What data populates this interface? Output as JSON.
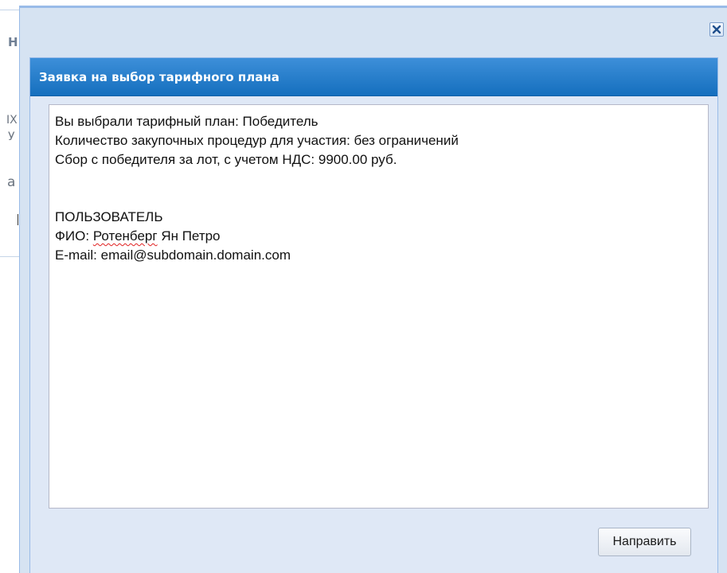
{
  "background": {
    "fragments": [
      "Н",
      "ІХ",
      "У",
      "а"
    ]
  },
  "window": {
    "close_icon": "close-icon"
  },
  "dialog": {
    "title": "Заявка на выбор тарифного плана",
    "text": {
      "plan_line": "Вы выбрали тарифный план: Победитель",
      "procedures_line": "Количество закупочных процедур для участия: без ограничений",
      "fee_line": "Сбор с победителя за лот, с учетом НДС: 9900.00 руб.",
      "user_heading": "ПОЛЬЗОВАТЕЛЬ",
      "fio_prefix": "ФИО: ",
      "fio_surname": "Ротенберг",
      "fio_rest": " Ян Петро",
      "email_line": "E-mail: email@subdomain.domain.com"
    },
    "submit_label": "Направить"
  }
}
